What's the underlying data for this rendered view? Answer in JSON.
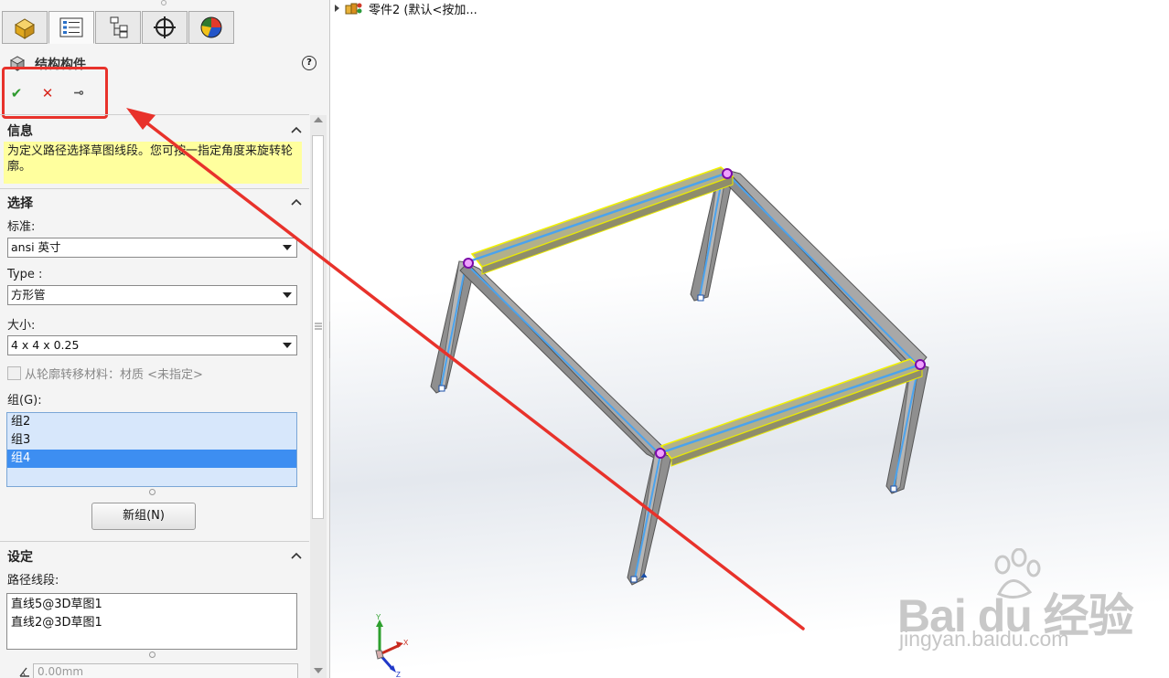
{
  "tabs": [
    {
      "icon": "part-icon"
    },
    {
      "icon": "property-manager-icon"
    },
    {
      "icon": "configuration-manager-icon"
    },
    {
      "icon": "dimxpert-icon"
    },
    {
      "icon": "display-manager-icon"
    }
  ],
  "property_manager": {
    "title": "结构构件",
    "help": "?",
    "ok": "✔",
    "cancel": "✕",
    "pin": "⊸"
  },
  "info_section": {
    "heading": "信息",
    "message": "为定义路径选择草图线段。您可按一指定角度来旋转轮廓。"
  },
  "selection_section": {
    "heading": "选择",
    "standard_label": "标准:",
    "standard_value": "ansi 英寸",
    "type_label": "Type :",
    "type_value": "方形管",
    "size_label": "大小:",
    "size_value": "4 x 4 x 0.25",
    "material_transfer": "从轮廓转移材料：材质 <未指定>",
    "group_label": "组(G):",
    "groups": [
      "组2",
      "组3",
      "组4"
    ],
    "selected_group_index": 2,
    "new_group_button": "新组(N)"
  },
  "settings_section": {
    "heading": "设定",
    "path_segments_label": "路径线段:",
    "path_segments": [
      "直线5@3D草图1",
      "直线2@3D草图1"
    ],
    "angle_value": "0.00mm"
  },
  "feature_tree": {
    "item": "零件2  (默认<按加..."
  },
  "triad": {
    "x": "X",
    "y": "Y",
    "z": "Z"
  },
  "watermark": {
    "brand": "Bai du 经验",
    "url": "jingyan.baidu.com"
  },
  "colors": {
    "annotation_red": "#e8322b",
    "highlight_yellow": "#ffff9e",
    "selection_blue": "#3d8ef1",
    "member_grey": "#9a9a9a",
    "sketch_line_blue": "#4aa3ee",
    "selected_edge_yellow": "#f2f200"
  }
}
